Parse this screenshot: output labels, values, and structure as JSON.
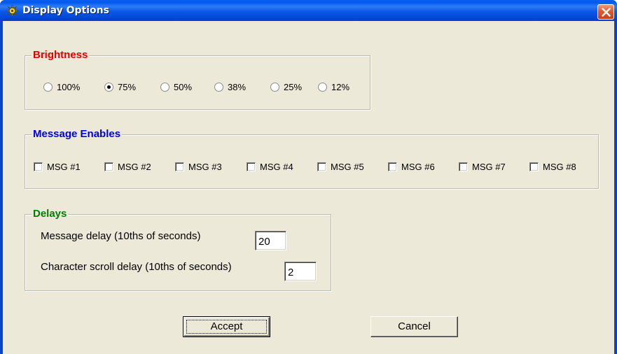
{
  "window": {
    "title": "Display Options",
    "icon": "sun-gear-icon",
    "close_icon": "close-x-icon"
  },
  "brightness": {
    "label": "Brightness",
    "label_color": "#e60000",
    "options": [
      "100%",
      "75%",
      "50%",
      "38%",
      "25%",
      "12%"
    ],
    "selected": "75%"
  },
  "message_enables": {
    "label": "Message Enables",
    "label_color": "#0000e6",
    "items": [
      {
        "label": "MSG #1",
        "checked": false
      },
      {
        "label": "MSG #2",
        "checked": false
      },
      {
        "label": "MSG #3",
        "checked": false
      },
      {
        "label": "MSG #4",
        "checked": false
      },
      {
        "label": "MSG #5",
        "checked": false
      },
      {
        "label": "MSG #6",
        "checked": false
      },
      {
        "label": "MSG #7",
        "checked": false
      },
      {
        "label": "MSG #8",
        "checked": false
      }
    ]
  },
  "delays": {
    "label": "Delays",
    "label_color": "#008000",
    "message_delay_label": "Message delay (10ths of seconds)",
    "message_delay_value": "20",
    "scroll_delay_label": "Character scroll delay (10ths of seconds)",
    "scroll_delay_value": "2"
  },
  "buttons": {
    "accept": "Accept",
    "cancel": "Cancel"
  }
}
